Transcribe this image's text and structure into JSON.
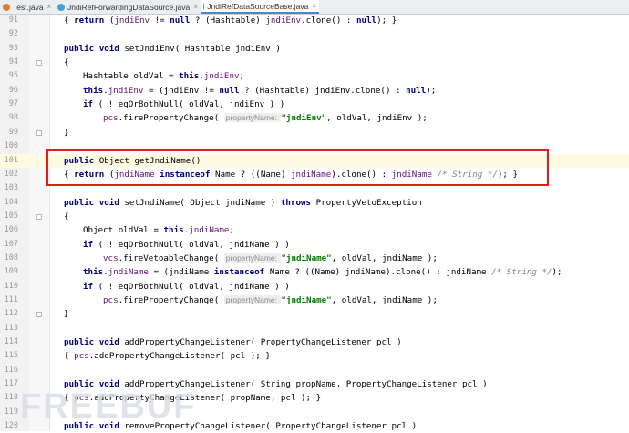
{
  "tabs": [
    {
      "label": "Test.java",
      "icon": "java-file-icon",
      "active": false
    },
    {
      "label": "JndiRefForwardingDataSource.java",
      "icon": "java-class-icon",
      "active": false
    },
    {
      "label": "JndiRefDataSourceBase.java",
      "icon": "java-class-icon",
      "active": true
    }
  ],
  "lines": [
    {
      "n": "91",
      "indent": 1,
      "segs": [
        [
          "t",
          "{ "
        ],
        [
          "kw",
          "return"
        ],
        [
          "t",
          " ("
        ],
        [
          "fld",
          "jndiEnv"
        ],
        [
          "t",
          " != "
        ],
        [
          "kw",
          "null"
        ],
        [
          "t",
          " ? (Hashtable) "
        ],
        [
          "fld",
          "jndiEnv"
        ],
        [
          "t",
          ".clone() : "
        ],
        [
          "kw",
          "null"
        ],
        [
          "t",
          "); }"
        ]
      ]
    },
    {
      "n": "92",
      "indent": 0,
      "segs": []
    },
    {
      "n": "93",
      "indent": 1,
      "segs": [
        [
          "kw",
          "public void"
        ],
        [
          "t",
          " setJndiEnv( Hashtable jndiEnv )"
        ]
      ]
    },
    {
      "n": "94",
      "indent": 1,
      "fold": true,
      "segs": [
        [
          "t",
          "{"
        ]
      ]
    },
    {
      "n": "95",
      "indent": 2,
      "segs": [
        [
          "t",
          "Hashtable oldVal = "
        ],
        [
          "kw",
          "this"
        ],
        [
          "t",
          "."
        ],
        [
          "fld",
          "jndiEnv"
        ],
        [
          "t",
          ";"
        ]
      ]
    },
    {
      "n": "96",
      "indent": 2,
      "segs": [
        [
          "kw",
          "this"
        ],
        [
          "t",
          "."
        ],
        [
          "fld",
          "jndiEnv"
        ],
        [
          "t",
          " = (jndiEnv != "
        ],
        [
          "kw",
          "null"
        ],
        [
          "t",
          " ? (Hashtable) jndiEnv.clone() : "
        ],
        [
          "kw",
          "null"
        ],
        [
          "t",
          ");"
        ]
      ]
    },
    {
      "n": "97",
      "indent": 2,
      "segs": [
        [
          "kw",
          "if"
        ],
        [
          "t",
          " ( ! eqOrBothNull( oldVal, jndiEnv ) )"
        ]
      ]
    },
    {
      "n": "98",
      "indent": 3,
      "segs": [
        [
          "fld",
          "pcs"
        ],
        [
          "t",
          ".firePropertyChange( "
        ],
        [
          "hint",
          "propertyName: "
        ],
        [
          "str",
          "\"jndiEnv\""
        ],
        [
          "t",
          ", oldVal, jndiEnv );"
        ]
      ]
    },
    {
      "n": "99",
      "indent": 1,
      "fold": true,
      "segs": [
        [
          "t",
          "}"
        ]
      ]
    },
    {
      "n": "100",
      "indent": 0,
      "segs": []
    },
    {
      "n": "101",
      "indent": 1,
      "current": true,
      "segs": [
        [
          "kw",
          "public"
        ],
        [
          "t",
          " Object getJndi"
        ],
        [
          "caret",
          ""
        ],
        [
          "t",
          "Name()"
        ]
      ]
    },
    {
      "n": "102",
      "indent": 1,
      "segs": [
        [
          "t",
          "{ "
        ],
        [
          "kw",
          "return"
        ],
        [
          "t",
          " ("
        ],
        [
          "fld",
          "jndiName"
        ],
        [
          "t",
          " "
        ],
        [
          "kw",
          "instanceof"
        ],
        [
          "t",
          " Name ? ((Name) "
        ],
        [
          "fld",
          "jndiName"
        ],
        [
          "t",
          ").clone() : "
        ],
        [
          "fld",
          "jndiName"
        ],
        [
          "t",
          " "
        ],
        [
          "cmt",
          "/* String */"
        ],
        [
          "t",
          "); }"
        ]
      ]
    },
    {
      "n": "103",
      "indent": 0,
      "segs": []
    },
    {
      "n": "104",
      "indent": 1,
      "segs": [
        [
          "kw",
          "public void"
        ],
        [
          "t",
          " setJndiName( Object jndiName ) "
        ],
        [
          "kw",
          "throws"
        ],
        [
          "t",
          " PropertyVetoException"
        ]
      ]
    },
    {
      "n": "105",
      "indent": 1,
      "fold": true,
      "segs": [
        [
          "t",
          "{"
        ]
      ]
    },
    {
      "n": "106",
      "indent": 2,
      "segs": [
        [
          "t",
          "Object oldVal = "
        ],
        [
          "kw",
          "this"
        ],
        [
          "t",
          "."
        ],
        [
          "fld",
          "jndiName"
        ],
        [
          "t",
          ";"
        ]
      ]
    },
    {
      "n": "107",
      "indent": 2,
      "segs": [
        [
          "kw",
          "if"
        ],
        [
          "t",
          " ( ! eqOrBothNull( oldVal, jndiName ) )"
        ]
      ]
    },
    {
      "n": "108",
      "indent": 3,
      "segs": [
        [
          "fld",
          "vcs"
        ],
        [
          "t",
          ".fireVetoableChange( "
        ],
        [
          "hint",
          "propertyName: "
        ],
        [
          "str",
          "\"jndiName\""
        ],
        [
          "t",
          ", oldVal, jndiName );"
        ]
      ]
    },
    {
      "n": "109",
      "indent": 2,
      "segs": [
        [
          "kw",
          "this"
        ],
        [
          "t",
          "."
        ],
        [
          "fld",
          "jndiName"
        ],
        [
          "t",
          " = (jndiName "
        ],
        [
          "kw",
          "instanceof"
        ],
        [
          "t",
          " Name ? ((Name) jndiName).clone() : jndiName "
        ],
        [
          "cmt",
          "/* String */"
        ],
        [
          "t",
          ");"
        ]
      ]
    },
    {
      "n": "110",
      "indent": 2,
      "segs": [
        [
          "kw",
          "if"
        ],
        [
          "t",
          " ( ! eqOrBothNull( oldVal, jndiName ) )"
        ]
      ]
    },
    {
      "n": "111",
      "indent": 3,
      "segs": [
        [
          "fld",
          "pcs"
        ],
        [
          "t",
          ".firePropertyChange( "
        ],
        [
          "hint",
          "propertyName: "
        ],
        [
          "str",
          "\"jndiName\""
        ],
        [
          "t",
          ", oldVal, jndiName );"
        ]
      ]
    },
    {
      "n": "112",
      "indent": 1,
      "fold": true,
      "segs": [
        [
          "t",
          "}"
        ]
      ]
    },
    {
      "n": "113",
      "indent": 0,
      "segs": []
    },
    {
      "n": "114",
      "indent": 1,
      "segs": [
        [
          "kw",
          "public void"
        ],
        [
          "t",
          " addPropertyChangeListener( PropertyChangeListener pcl )"
        ]
      ]
    },
    {
      "n": "115",
      "indent": 1,
      "segs": [
        [
          "t",
          "{ "
        ],
        [
          "fld",
          "pcs"
        ],
        [
          "t",
          ".addPropertyChangeListener( pcl ); }"
        ]
      ]
    },
    {
      "n": "116",
      "indent": 0,
      "segs": []
    },
    {
      "n": "117",
      "indent": 1,
      "segs": [
        [
          "kw",
          "public void"
        ],
        [
          "t",
          " addPropertyChangeListener( String propName, PropertyChangeListener pcl )"
        ]
      ]
    },
    {
      "n": "118",
      "indent": 1,
      "segs": [
        [
          "t",
          "{ "
        ],
        [
          "fld",
          "pcs"
        ],
        [
          "t",
          ".addPropertyChangeListener( propName, pcl ); }"
        ]
      ]
    },
    {
      "n": "119",
      "indent": 0,
      "segs": []
    },
    {
      "n": "120",
      "indent": 1,
      "segs": [
        [
          "kw",
          "public void"
        ],
        [
          "t",
          " removePropertyChangeListener( PropertyChangeListener pcl )"
        ]
      ]
    }
  ],
  "watermark": "FREEBUF",
  "colors": {
    "highlight_box": "#e31b1b",
    "keyword": "#000080",
    "field": "#660e7a",
    "string": "#008000",
    "comment": "#808080"
  }
}
